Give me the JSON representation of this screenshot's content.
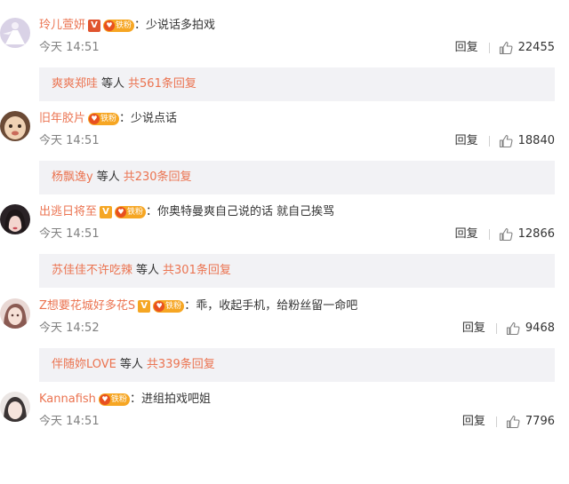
{
  "comments": [
    {
      "username": "玲儿萱妍",
      "v_badge": "V",
      "v_color": "#e0542e",
      "fan_badge": "铁粉",
      "text": "少说话多拍戏",
      "time": "今天 14:51",
      "reply_label": "回复",
      "likes": "22455",
      "reply_user": "爽爽郑哇",
      "reply_mid": "等人",
      "reply_count": "共561条回复",
      "avatar": "avatar-dancer"
    },
    {
      "username": "旧年胶片",
      "v_badge": "",
      "fan_badge": "铁粉",
      "text": "少说点话",
      "time": "今天 14:51",
      "reply_label": "回复",
      "likes": "18840",
      "reply_user": "杨飘逸y",
      "reply_mid": "等人",
      "reply_count": "共230条回复",
      "avatar": "avatar-baby"
    },
    {
      "username": "出逃日将至",
      "v_badge": "V",
      "v_color": "#f5a623",
      "fan_badge": "铁粉",
      "text": "你奥特曼爽自己说的话 就自己挨骂",
      "time": "今天 14:51",
      "reply_label": "回复",
      "likes": "12866",
      "reply_user": "苏佳佳不许吃辣",
      "reply_mid": "等人",
      "reply_count": "共301条回复",
      "avatar": "avatar-girl"
    },
    {
      "username": "Z想要花城好多花S",
      "v_badge": "V",
      "v_color": "#f5a623",
      "fan_badge": "铁粉",
      "text": "乖，收起手机，给粉丝留一命吧",
      "time": "今天 14:52",
      "reply_label": "回复",
      "likes": "9468",
      "reply_user": "伴随妳LOVE",
      "reply_mid": "等人",
      "reply_count": "共339条回复",
      "avatar": "avatar-anime"
    },
    {
      "username": "Kannafish",
      "v_badge": "",
      "fan_badge": "铁粉",
      "text": "进组拍戏吧姐",
      "time": "今天 14:51",
      "reply_label": "回复",
      "likes": "7796",
      "reply_user": "",
      "reply_mid": "",
      "reply_count": "",
      "avatar": "avatar-woman"
    }
  ]
}
